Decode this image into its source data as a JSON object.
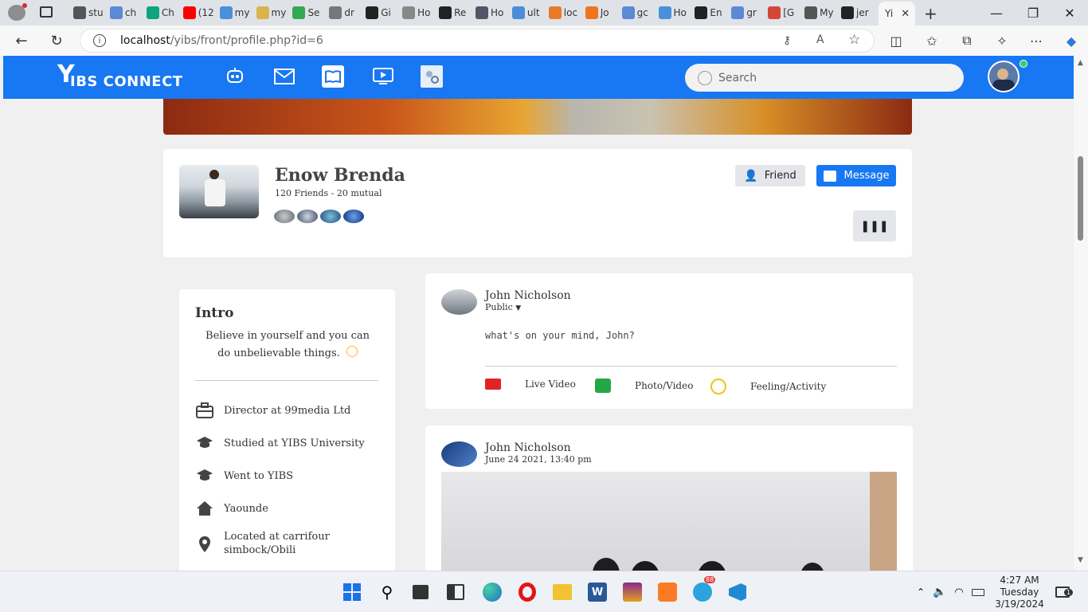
{
  "browser": {
    "tabs": [
      {
        "label": "stu",
        "color": "#555555"
      },
      {
        "label": "ch",
        "color": "#5a8ad6"
      },
      {
        "label": "Ch",
        "color": "#10a37f"
      },
      {
        "label": "(12",
        "color": "#ff0000"
      },
      {
        "label": "my",
        "color": "#4a90d9"
      },
      {
        "label": "my",
        "color": "#d9b44a"
      },
      {
        "label": "Se",
        "color": "#34a853"
      },
      {
        "label": "dr",
        "color": "#777777"
      },
      {
        "label": "Gi",
        "color": "#222222"
      },
      {
        "label": "Ho",
        "color": "#888888"
      },
      {
        "label": "Re",
        "color": "#222222"
      },
      {
        "label": "Ho",
        "color": "#555566"
      },
      {
        "label": "ult",
        "color": "#4a8fd6"
      },
      {
        "label": "loc",
        "color": "#e87a2a"
      },
      {
        "label": "Jo",
        "color": "#f0741e"
      },
      {
        "label": "gc",
        "color": "#5a8ad6"
      },
      {
        "label": "Ho",
        "color": "#4a90d9"
      },
      {
        "label": "En",
        "color": "#222222"
      },
      {
        "label": "gr",
        "color": "#5a8ad6"
      },
      {
        "label": "[G",
        "color": "#d44638"
      },
      {
        "label": "My",
        "color": "#555555"
      },
      {
        "label": "jer",
        "color": "#222222"
      }
    ],
    "active_tab": {
      "label": "Yi"
    },
    "url_host": "localhost",
    "url_path": "/yibs/front/profile.php?id=6"
  },
  "site": {
    "logo_text": "IBS CONNECT",
    "search_placeholder": "Search",
    "nav_icons": [
      "chatbot-icon",
      "mail-icon",
      "book-icon",
      "video-icon",
      "people-search-icon"
    ]
  },
  "profile": {
    "name": "Enow Brenda",
    "friends_text": "120 Friends - 20 mutual",
    "friend_button": "Friend",
    "message_button": "Message",
    "more_button": "❚❚❚"
  },
  "intro": {
    "title": "Intro",
    "bio": "Believe in yourself and you can do unbelievable things.",
    "items": [
      {
        "icon": "briefcase-icon",
        "text": "Director at 99media Ltd"
      },
      {
        "icon": "graduation-cap-icon",
        "text": "Studied at YIBS University"
      },
      {
        "icon": "graduation-cap-icon",
        "text": "Went to YIBS"
      },
      {
        "icon": "home-icon",
        "text": "Yaounde"
      },
      {
        "icon": "location-pin-icon",
        "text": "Located at carrifour simbock/Obili"
      }
    ]
  },
  "composer": {
    "author": "John Nicholson",
    "privacy": "Public",
    "placeholder": "what's on your mind, John?",
    "actions": [
      "Live Video",
      "Photo/Video",
      "Feeling/Activity"
    ]
  },
  "post": {
    "author": "John Nicholson",
    "date": "June 24 2021, 13:40 pm"
  },
  "taskbar": {
    "time": "4:27 AM",
    "day": "Tuesday",
    "date": "3/19/2024",
    "telegram_badge": "88",
    "notif_badge": "1"
  }
}
